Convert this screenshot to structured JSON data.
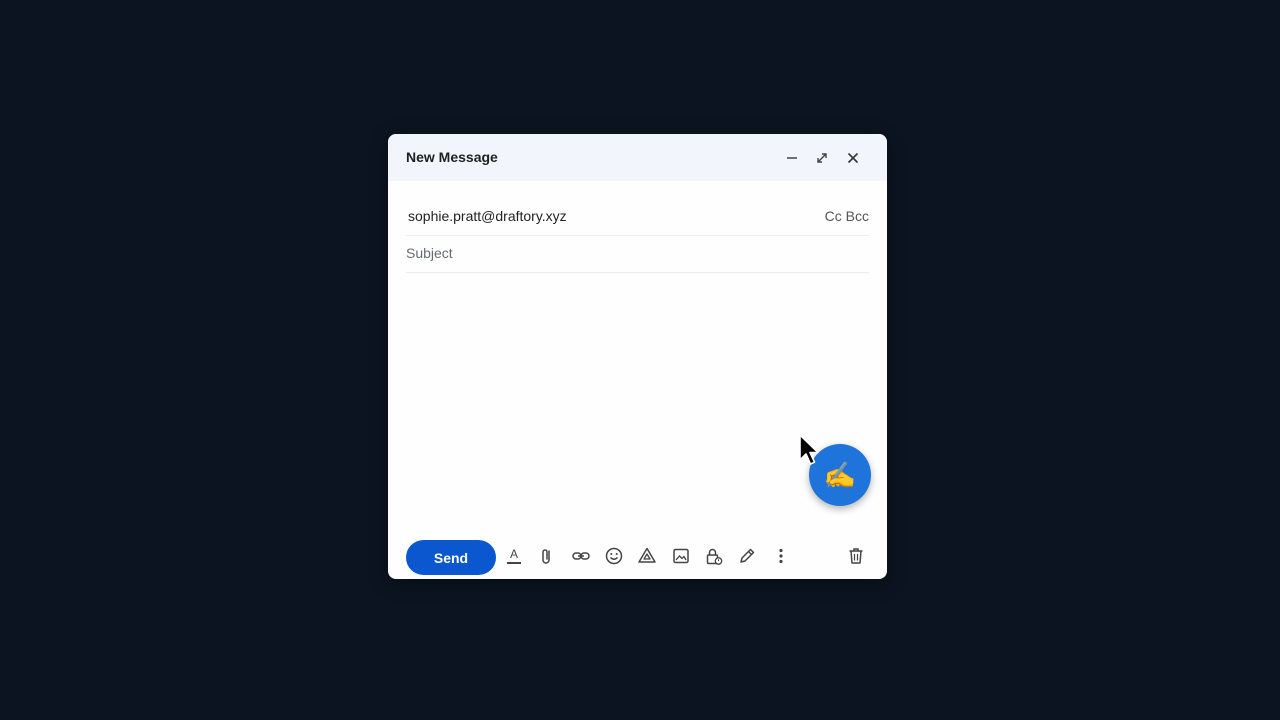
{
  "window": {
    "title": "New Message"
  },
  "header_controls": {
    "minimize_icon": "minimize-icon",
    "fullscreen_icon": "expand-icon",
    "close_icon": "close-icon"
  },
  "to": {
    "value": "sophie.pratt@draftory.xyz",
    "cc_bcc_label": "Cc Bcc"
  },
  "subject": {
    "placeholder": "Subject",
    "value": ""
  },
  "body": {
    "value": ""
  },
  "toolbar": {
    "send_label": "Send",
    "tools": [
      "formatting-options-icon",
      "attach-file-icon",
      "insert-link-icon",
      "emoji-icon",
      "drive-icon",
      "insert-photo-icon",
      "confidential-mode-icon",
      "signature-icon",
      "more-options-icon"
    ],
    "discard_icon": "trash-icon"
  },
  "fab": {
    "glyph": "✍️"
  },
  "colors": {
    "background": "#0b1420",
    "header": "#f2f6fc",
    "send": "#0b57d0",
    "fab": "#1f74dc"
  }
}
